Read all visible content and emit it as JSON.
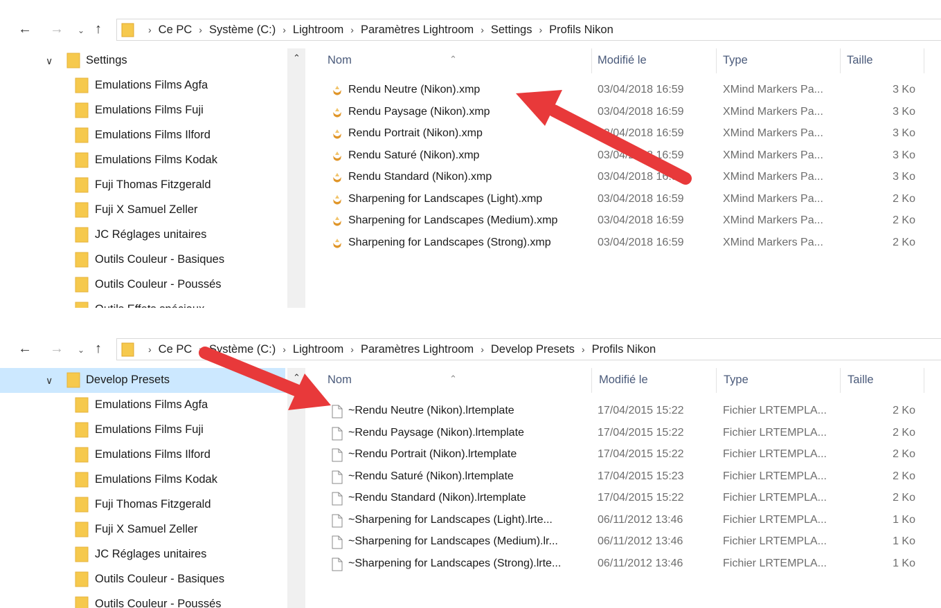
{
  "top": {
    "breadcrumb": [
      "Ce PC",
      "Système (C:)",
      "Lightroom",
      "Paramètres Lightroom",
      "Settings",
      "Profils Nikon"
    ],
    "tree": [
      {
        "label": "Settings",
        "expanded": true
      },
      {
        "label": "Emulations Films Agfa"
      },
      {
        "label": "Emulations Films Fuji"
      },
      {
        "label": "Emulations Films Ilford"
      },
      {
        "label": "Emulations Films Kodak"
      },
      {
        "label": "Fuji Thomas Fitzgerald"
      },
      {
        "label": "Fuji X Samuel Zeller"
      },
      {
        "label": "JC Réglages unitaires"
      },
      {
        "label": "Outils Couleur - Basiques"
      },
      {
        "label": "Outils Couleur - Poussés"
      },
      {
        "label": "Outils Effets spéciaux"
      }
    ],
    "columns": {
      "name": "Nom",
      "modified": "Modifié le",
      "type": "Type",
      "size": "Taille"
    },
    "files": [
      {
        "name": "Rendu Neutre (Nikon).xmp",
        "date": "03/04/2018 16:59",
        "type": "XMind Markers Pa...",
        "size": "3 Ko"
      },
      {
        "name": "Rendu Paysage (Nikon).xmp",
        "date": "03/04/2018 16:59",
        "type": "XMind Markers Pa...",
        "size": "3 Ko"
      },
      {
        "name": "Rendu Portrait (Nikon).xmp",
        "date": "03/04/2018 16:59",
        "type": "XMind Markers Pa...",
        "size": "3 Ko"
      },
      {
        "name": "Rendu Saturé (Nikon).xmp",
        "date": "03/04/2018 16:59",
        "type": "XMind Markers Pa...",
        "size": "3 Ko"
      },
      {
        "name": "Rendu Standard (Nikon).xmp",
        "date": "03/04/2018 16:59",
        "type": "XMind Markers Pa...",
        "size": "3 Ko"
      },
      {
        "name": "Sharpening for Landscapes (Light).xmp",
        "date": "03/04/2018 16:59",
        "type": "XMind Markers Pa...",
        "size": "2 Ko"
      },
      {
        "name": "Sharpening for Landscapes (Medium).xmp",
        "date": "03/04/2018 16:59",
        "type": "XMind Markers Pa...",
        "size": "2 Ko"
      },
      {
        "name": "Sharpening for Landscapes (Strong).xmp",
        "date": "03/04/2018 16:59",
        "type": "XMind Markers Pa...",
        "size": "2 Ko"
      }
    ]
  },
  "bottom": {
    "breadcrumb": [
      "Ce PC",
      "Système (C:)",
      "Lightroom",
      "Paramètres Lightroom",
      "Develop Presets",
      "Profils Nikon"
    ],
    "tree": [
      {
        "label": "Develop Presets",
        "expanded": true,
        "selected": true
      },
      {
        "label": "Emulations Films Agfa"
      },
      {
        "label": "Emulations Films Fuji"
      },
      {
        "label": "Emulations Films Ilford"
      },
      {
        "label": "Emulations Films Kodak"
      },
      {
        "label": "Fuji Thomas Fitzgerald"
      },
      {
        "label": "Fuji X Samuel Zeller"
      },
      {
        "label": "JC Réglages unitaires"
      },
      {
        "label": "Outils Couleur - Basiques"
      },
      {
        "label": "Outils Couleur - Poussés"
      }
    ],
    "columns": {
      "name": "Nom",
      "modified": "Modifié le",
      "type": "Type",
      "size": "Taille"
    },
    "files": [
      {
        "name": "~Rendu Neutre (Nikon).lrtemplate",
        "date": "17/04/2015 15:22",
        "type": "Fichier LRTEMPLA...",
        "size": "2 Ko"
      },
      {
        "name": "~Rendu Paysage (Nikon).lrtemplate",
        "date": "17/04/2015 15:22",
        "type": "Fichier LRTEMPLA...",
        "size": "2 Ko"
      },
      {
        "name": "~Rendu Portrait (Nikon).lrtemplate",
        "date": "17/04/2015 15:22",
        "type": "Fichier LRTEMPLA...",
        "size": "2 Ko"
      },
      {
        "name": "~Rendu Saturé (Nikon).lrtemplate",
        "date": "17/04/2015 15:23",
        "type": "Fichier LRTEMPLA...",
        "size": "2 Ko"
      },
      {
        "name": "~Rendu Standard (Nikon).lrtemplate",
        "date": "17/04/2015 15:22",
        "type": "Fichier LRTEMPLA...",
        "size": "2 Ko"
      },
      {
        "name": "~Sharpening for Landscapes (Light).lrte...",
        "date": "06/11/2012 13:46",
        "type": "Fichier LRTEMPLA...",
        "size": "1 Ko"
      },
      {
        "name": "~Sharpening for Landscapes (Medium).lr...",
        "date": "06/11/2012 13:46",
        "type": "Fichier LRTEMPLA...",
        "size": "1 Ko"
      },
      {
        "name": "~Sharpening for Landscapes (Strong).lrte...",
        "date": "06/11/2012 13:46",
        "type": "Fichier LRTEMPLA...",
        "size": "1 Ko"
      }
    ]
  },
  "icons": {
    "back": "arrow-left-icon",
    "forward": "arrow-right-icon",
    "recent": "chevron-down-icon",
    "up": "arrow-up-icon",
    "folder": "folder-icon",
    "xmp_file": "xmp-file-icon",
    "template_file": "generic-file-icon",
    "annotation": "red-arrow-icon"
  },
  "colors": {
    "folder": "#f6c94d",
    "selected": "#cce8ff",
    "arrow": "#e8393a",
    "xmp_icon": "#e0962a"
  }
}
